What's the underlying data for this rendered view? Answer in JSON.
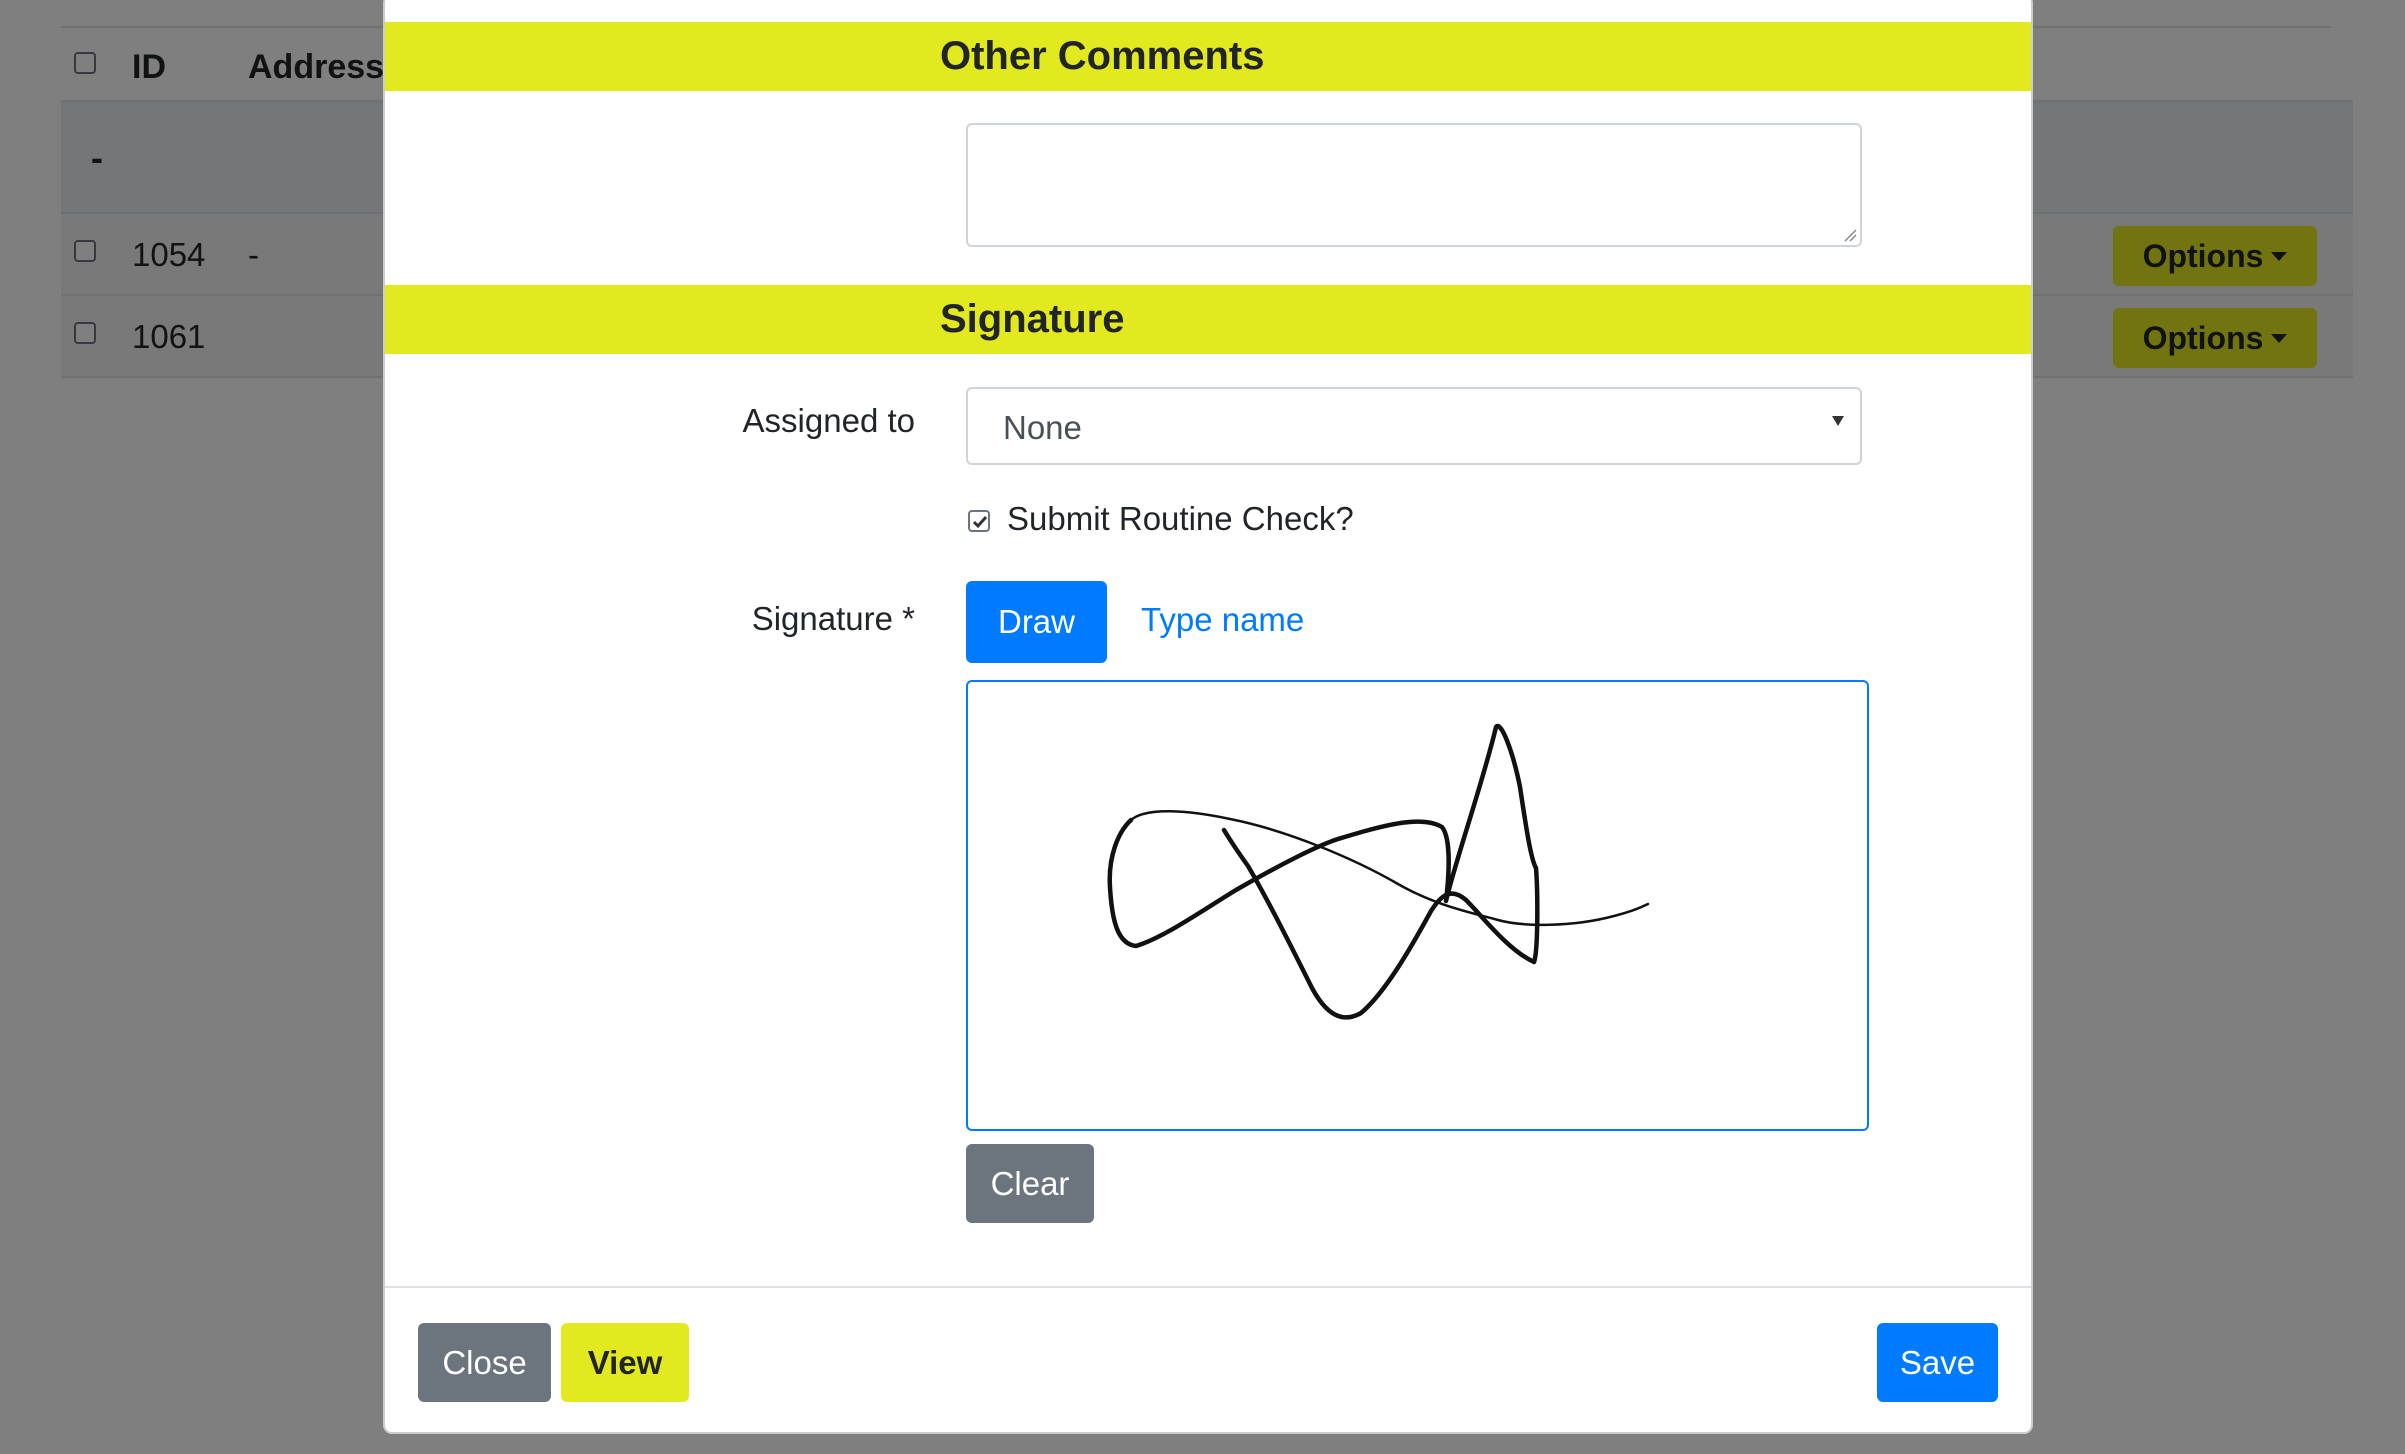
{
  "table": {
    "headers": {
      "id": "ID",
      "address": "Address"
    },
    "group_label": "-",
    "rows": [
      {
        "id": "1054",
        "address": "-",
        "options_label": "Options"
      },
      {
        "id": "1061",
        "address": "",
        "options_label": "Options"
      }
    ]
  },
  "modal": {
    "other_comments": {
      "title": "Other Comments",
      "value": ""
    },
    "signature_section": {
      "title": "Signature",
      "assigned_label": "Assigned to",
      "assigned_value": "None",
      "checkbox_label": "Submit Routine Check?",
      "checkbox_checked": true,
      "signature_label": "Signature *",
      "draw_label": "Draw",
      "type_label": "Type name",
      "clear_label": "Clear"
    },
    "footer": {
      "close_label": "Close",
      "view_label": "View",
      "save_label": "Save"
    }
  },
  "colors": {
    "accent_yellow": "#e2e91f",
    "primary_blue": "#007bff",
    "secondary_gray": "#6c757d"
  }
}
